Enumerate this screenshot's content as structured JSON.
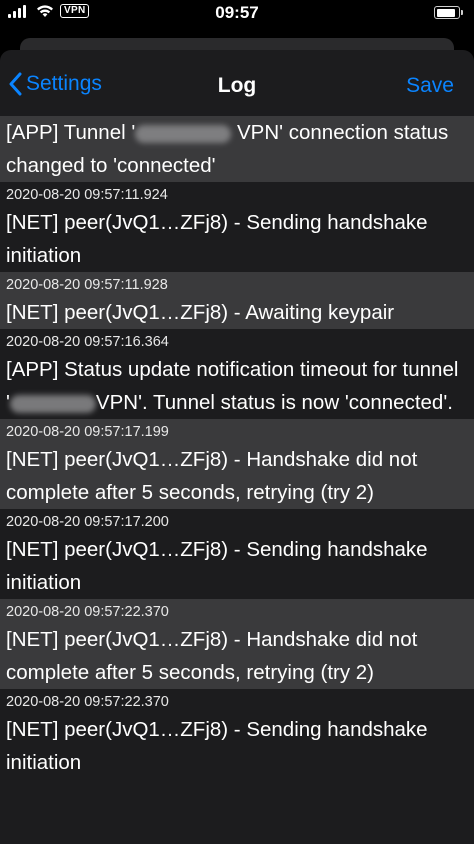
{
  "status_bar": {
    "time": "09:57",
    "vpn_badge": "VPN",
    "signal_icon": "cellular-signal-icon",
    "wifi_icon": "wifi-icon",
    "battery_icon": "battery-icon"
  },
  "nav": {
    "back_label": "Settings",
    "title": "Log",
    "save_label": "Save"
  },
  "colors": {
    "accent": "#0a84ff",
    "sheet_bg": "#1c1c1e",
    "row_alt_bg": "#3a3a3c"
  },
  "log_entries": [
    {
      "timestamp": "",
      "message_before": "[APP] Tunnel '",
      "message_after": "VPN' connection status changed to 'connected'"
    },
    {
      "timestamp": "2020-08-20 09:57:11.924",
      "message": "[NET] peer(JvQ1…ZFj8) - Sending handshake initiation"
    },
    {
      "timestamp": "2020-08-20 09:57:11.928",
      "message": "[NET] peer(JvQ1…ZFj8) - Awaiting keypair"
    },
    {
      "timestamp": "2020-08-20 09:57:16.364",
      "message_before": "[APP] Status update notification timeout for tunnel '",
      "message_after": "VPN'. Tunnel status is now 'connected'."
    },
    {
      "timestamp": "2020-08-20 09:57:17.199",
      "message": "[NET] peer(JvQ1…ZFj8) - Handshake did not complete after 5 seconds, retrying (try 2)"
    },
    {
      "timestamp": "2020-08-20 09:57:17.200",
      "message": "[NET] peer(JvQ1…ZFj8) - Sending handshake initiation"
    },
    {
      "timestamp": "2020-08-20 09:57:22.370",
      "message": "[NET] peer(JvQ1…ZFj8) - Handshake did not complete after 5 seconds, retrying (try 2)"
    },
    {
      "timestamp": "2020-08-20 09:57:22.370",
      "message": "[NET] peer(JvQ1…ZFj8) - Sending handshake initiation"
    }
  ]
}
